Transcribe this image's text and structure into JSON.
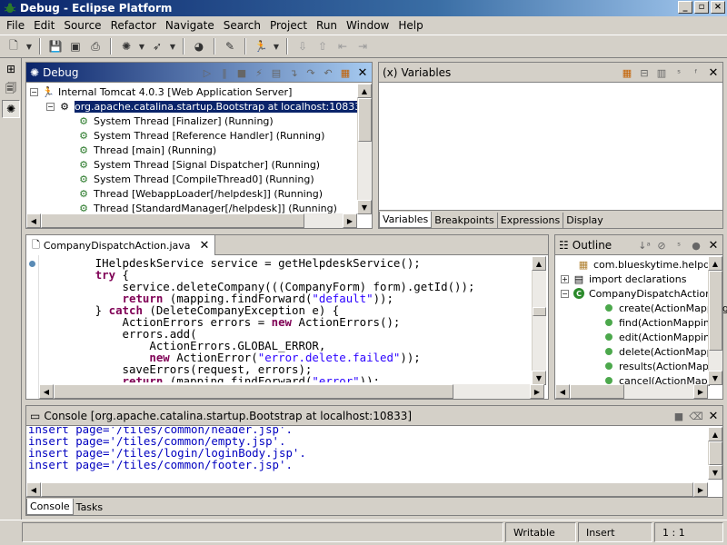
{
  "window": {
    "title": "Debug - Eclipse Platform",
    "min_label": "_",
    "max_label": "▫",
    "close_label": "×"
  },
  "menu": [
    "File",
    "Edit",
    "Source",
    "Refactor",
    "Navigate",
    "Search",
    "Project",
    "Run",
    "Window",
    "Help"
  ],
  "debug_view": {
    "title": "Debug",
    "tree": [
      {
        "label": "Internal Tomcat 4.0.3 [Web Application Server]"
      },
      {
        "label": "org.apache.catalina.startup.Bootstrap at localhost:10833",
        "selected": true
      },
      {
        "label": "System Thread [Finalizer] (Running)"
      },
      {
        "label": "System Thread [Reference Handler] (Running)"
      },
      {
        "label": "Thread [main] (Running)"
      },
      {
        "label": "System Thread [Signal Dispatcher] (Running)"
      },
      {
        "label": "System Thread [CompileThread0] (Running)"
      },
      {
        "label": "Thread [WebappLoader[/helpdesk]] (Running)"
      },
      {
        "label": "Thread [StandardManager[/helpdesk]] (Running)"
      }
    ]
  },
  "variables_view": {
    "title": "Variables",
    "tabs": [
      "Variables",
      "Breakpoints",
      "Expressions",
      "Display"
    ],
    "active_tab": "Variables"
  },
  "editor": {
    "tab_label": "CompanyDispatchAction.java",
    "lines": [
      "        IHelpdeskService service = getHelpdeskService();",
      "        try {",
      "            service.deleteCompany(((CompanyForm) form).getId());",
      "            return (mapping.findForward(\"default\"));",
      "        } catch (DeleteCompanyException e) {",
      "            ActionErrors errors = new ActionErrors();",
      "            errors.add(",
      "                ActionErrors.GLOBAL_ERROR,",
      "                new ActionError(\"error.delete.failed\"));",
      "            saveErrors(request, errors);",
      "            return (mapping.findForward(\"error\"));"
    ]
  },
  "outline_view": {
    "title": "Outline",
    "items": [
      {
        "label": "com.blueskytime.helpdes"
      },
      {
        "label": "import declarations"
      },
      {
        "label": "CompanyDispatchAction"
      },
      {
        "label": "create(ActionMapping"
      },
      {
        "label": "find(ActionMapping,"
      },
      {
        "label": "edit(ActionMapping,"
      },
      {
        "label": "delete(ActionMappi"
      },
      {
        "label": "results(ActionMappi"
      },
      {
        "label": "cancel(ActionMappi"
      }
    ]
  },
  "console_view": {
    "title": "Console [org.apache.catalina.startup.Bootstrap at localhost:10833]",
    "lines": [
      "insert page='/tiles/common/header.jsp'.",
      "insert page='/tiles/common/empty.jsp'.",
      "insert page='/tiles/login/loginBody.jsp'.",
      "insert page='/tiles/common/footer.jsp'."
    ],
    "tabs": [
      "Console",
      "Tasks"
    ],
    "active_tab": "Console"
  },
  "status": {
    "writable": "Writable",
    "insert": "Insert",
    "position": "1 : 1"
  },
  "colors": {
    "title_bar": "#0a246a",
    "keyword": "#7f0055",
    "string": "#2a00ff",
    "console_text": "#0000c0"
  }
}
